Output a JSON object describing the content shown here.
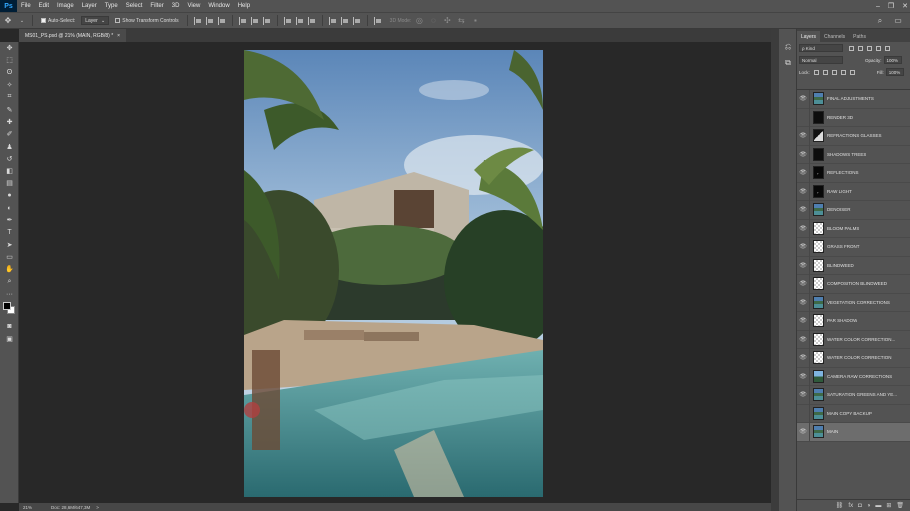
{
  "app": {
    "logo": "Ps"
  },
  "menu": [
    "File",
    "Edit",
    "Image",
    "Layer",
    "Type",
    "Select",
    "Filter",
    "3D",
    "View",
    "Window",
    "Help"
  ],
  "options": {
    "auto_select_label": "Auto-Select:",
    "auto_select_value": "Layer",
    "show_transform_label": "Show Transform Controls",
    "mode_3d_label": "3D Mode:"
  },
  "document": {
    "tab_title": "MS01_PS.psd @ 21% (MAIN, RGB/8) *",
    "close": "×"
  },
  "status": {
    "zoom": "21%",
    "doc_size": "Doc: 28,6M/647,3M",
    "arrow": ">"
  },
  "panel": {
    "tabs": [
      "Layers",
      "Channels",
      "Paths"
    ],
    "kind_label": "ρ Kind",
    "blend_mode": "Normal",
    "opacity_label": "Opacity:",
    "opacity_value": "100%",
    "lock_label": "Lock:",
    "fill_label": "Fill:",
    "fill_value": "100%"
  },
  "layers": [
    {
      "name": "FINAL ADJUSTMENTS",
      "thumb": "photo",
      "visible": true,
      "selected": false
    },
    {
      "name": "RENDER 3D",
      "thumb": "dark",
      "visible": false,
      "selected": false
    },
    {
      "name": "REFRACTIONS GLASSES",
      "thumb": "half",
      "visible": true,
      "selected": false
    },
    {
      "name": "SHADOWS TREES",
      "thumb": "dark",
      "visible": true,
      "selected": false
    },
    {
      "name": "REFLECTIONS",
      "thumb": "darkspeck",
      "visible": true,
      "selected": false
    },
    {
      "name": "RAW LIGHT",
      "thumb": "darkspeck",
      "visible": true,
      "selected": false
    },
    {
      "name": "DENOISER",
      "thumb": "photo",
      "visible": true,
      "selected": false
    },
    {
      "name": "BLOOM PALMS",
      "thumb": "checker",
      "visible": true,
      "selected": false
    },
    {
      "name": "GRASS FRONT",
      "thumb": "checker",
      "visible": true,
      "selected": false
    },
    {
      "name": "BLINDWEED",
      "thumb": "checker",
      "visible": true,
      "selected": false
    },
    {
      "name": "COMPOSITION BLINDWEED",
      "thumb": "checker",
      "visible": true,
      "selected": false
    },
    {
      "name": "VEGETATION CORRECTIONS",
      "thumb": "photo",
      "visible": true,
      "selected": false
    },
    {
      "name": "PAR SHADOW",
      "thumb": "checker",
      "visible": true,
      "selected": false
    },
    {
      "name": "WATER COLOR CORRECTION...",
      "thumb": "checker",
      "visible": true,
      "selected": false
    },
    {
      "name": "WATER COLOR CORRECTION",
      "thumb": "checker",
      "visible": true,
      "selected": false
    },
    {
      "name": "CAMERA RAW CORRECTIONS",
      "thumb": "sky",
      "visible": true,
      "selected": false
    },
    {
      "name": "SATURATION GREENS AND YE...",
      "thumb": "photo",
      "visible": true,
      "selected": false
    },
    {
      "name": "MAIN COPY BACKUP",
      "thumb": "photo",
      "visible": false,
      "selected": false
    },
    {
      "name": "MAIN",
      "thumb": "photo",
      "visible": true,
      "selected": true
    }
  ]
}
